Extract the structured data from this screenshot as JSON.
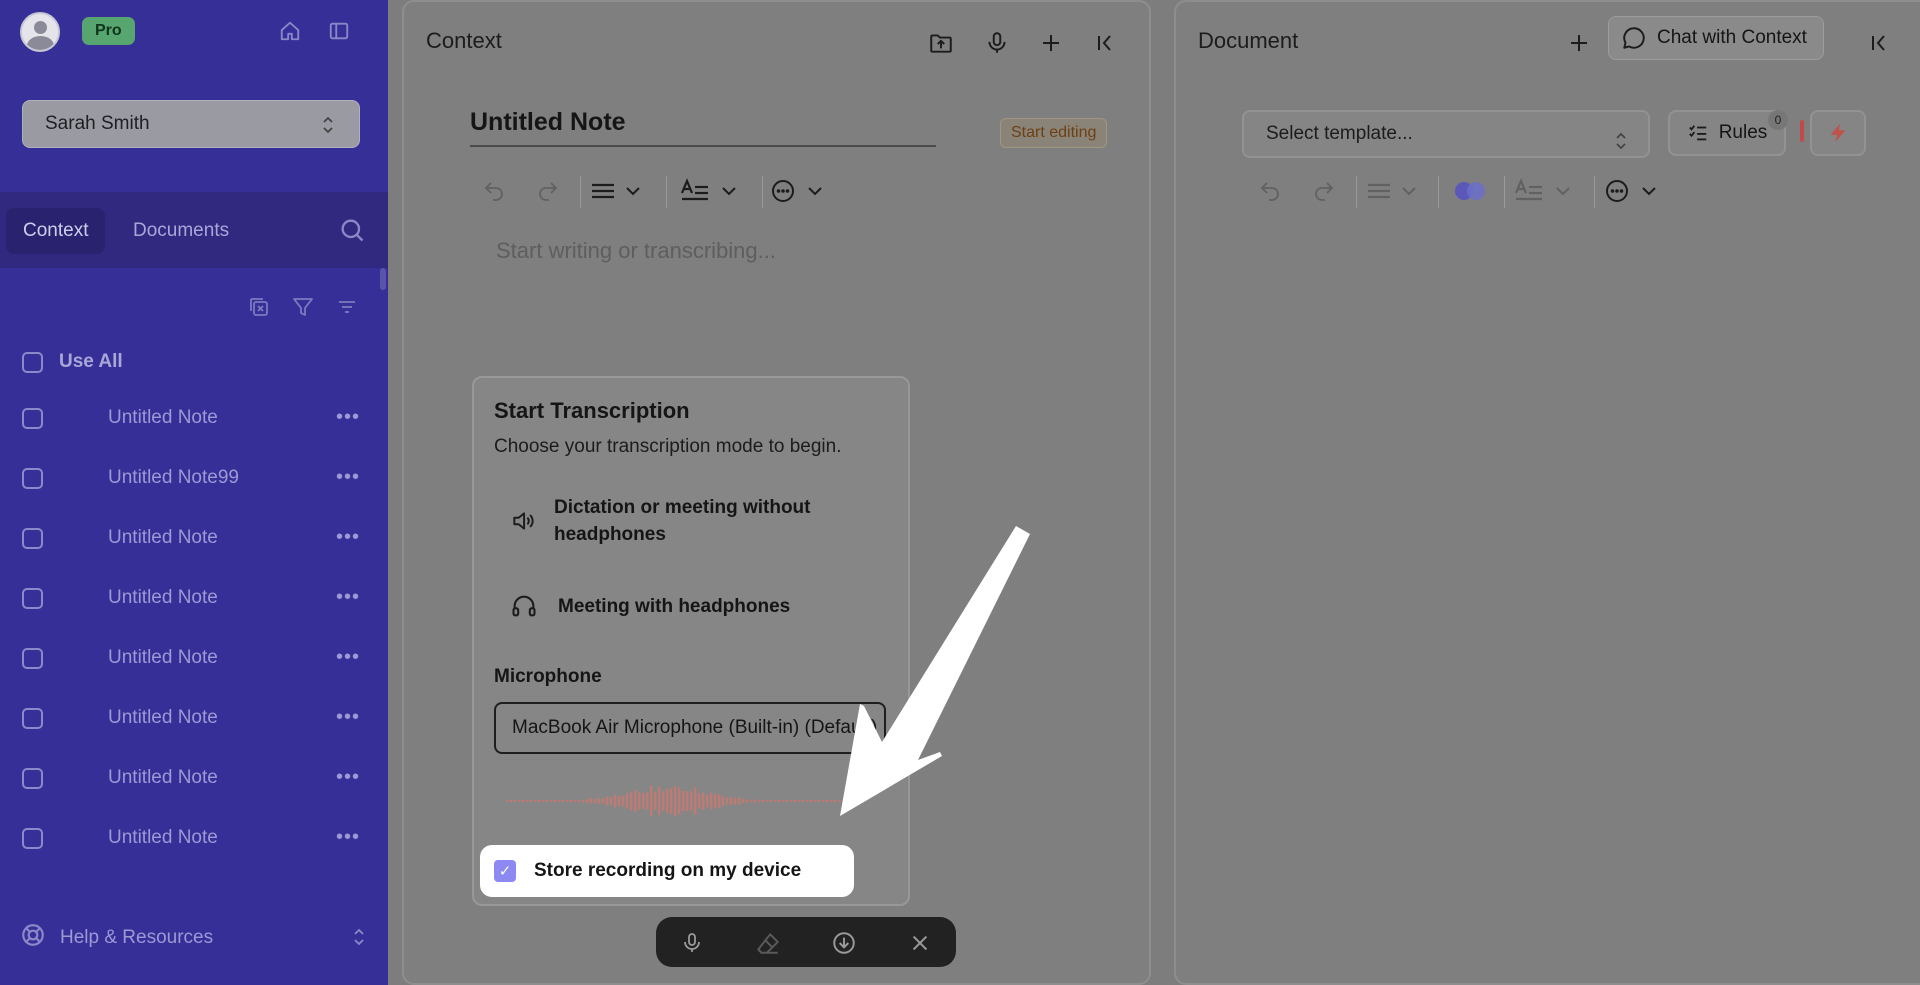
{
  "sidebar": {
    "plan_badge": "Pro",
    "user_name": "Sarah Smith",
    "tabs": [
      {
        "label": "Context"
      },
      {
        "label": "Documents"
      }
    ],
    "use_all_label": "Use All",
    "notes": [
      {
        "title": "Untitled Note"
      },
      {
        "title": "Untitled Note99"
      },
      {
        "title": "Untitled Note"
      },
      {
        "title": "Untitled Note"
      },
      {
        "title": "Untitled Note"
      },
      {
        "title": "Untitled Note"
      },
      {
        "title": "Untitled Note"
      },
      {
        "title": "Untitled Note"
      }
    ],
    "more_glyph": "•••",
    "help_label": "Help & Resources"
  },
  "context_panel": {
    "title": "Context",
    "note_title": "Untitled Note",
    "start_editing_label": "Start editing",
    "editor_placeholder": "Start writing or transcribing..."
  },
  "transcription": {
    "title": "Start Transcription",
    "subtitle": "Choose your transcription mode to begin.",
    "modes": [
      {
        "line1": "Dictation or meeting without",
        "line2": "headphones",
        "icon": "speaker-icon"
      },
      {
        "line1": "Meeting with headphones",
        "icon": "headphones-icon"
      }
    ],
    "microphone_label": "Microphone",
    "microphone_value": "MacBook Air Microphone (Built-in) (Default)",
    "store_recording_label": "Store recording on my device",
    "store_recording_checked": true,
    "check_glyph": "✓"
  },
  "document_panel": {
    "title": "Document",
    "chat_button_label": "Chat with Context",
    "template_placeholder": "Select template...",
    "rules_label": "Rules",
    "rules_count": "0"
  },
  "colors": {
    "sidebar_bg": "#372f98",
    "pro_badge": "#57a56f",
    "checkbox_accent": "#8d89f3",
    "waveform": "#c07a74"
  }
}
